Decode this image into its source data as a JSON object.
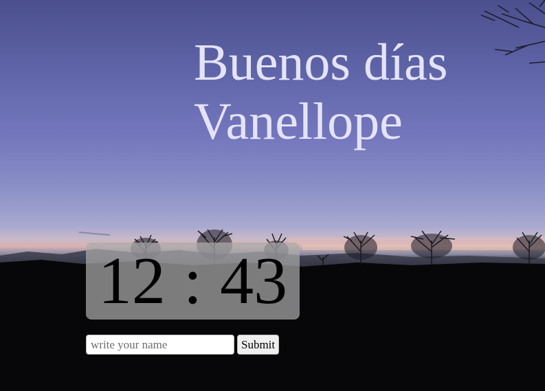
{
  "greeting": {
    "salutation": "Buenos días",
    "name": "Vanellope"
  },
  "clock": {
    "hours": "12",
    "separator": ":",
    "minutes": "43"
  },
  "name_form": {
    "placeholder": "write your name",
    "value": "",
    "submit_label": "Submit"
  },
  "colors": {
    "greeting_text": "#e4e3f7",
    "clock_panel": "#aaaaaa",
    "sky_top": "#4b4f8d",
    "sky_mid": "#7477bd",
    "horizon_glow": "#d9b2b3"
  },
  "background": {
    "icon": "sunset-landscape-photo"
  }
}
